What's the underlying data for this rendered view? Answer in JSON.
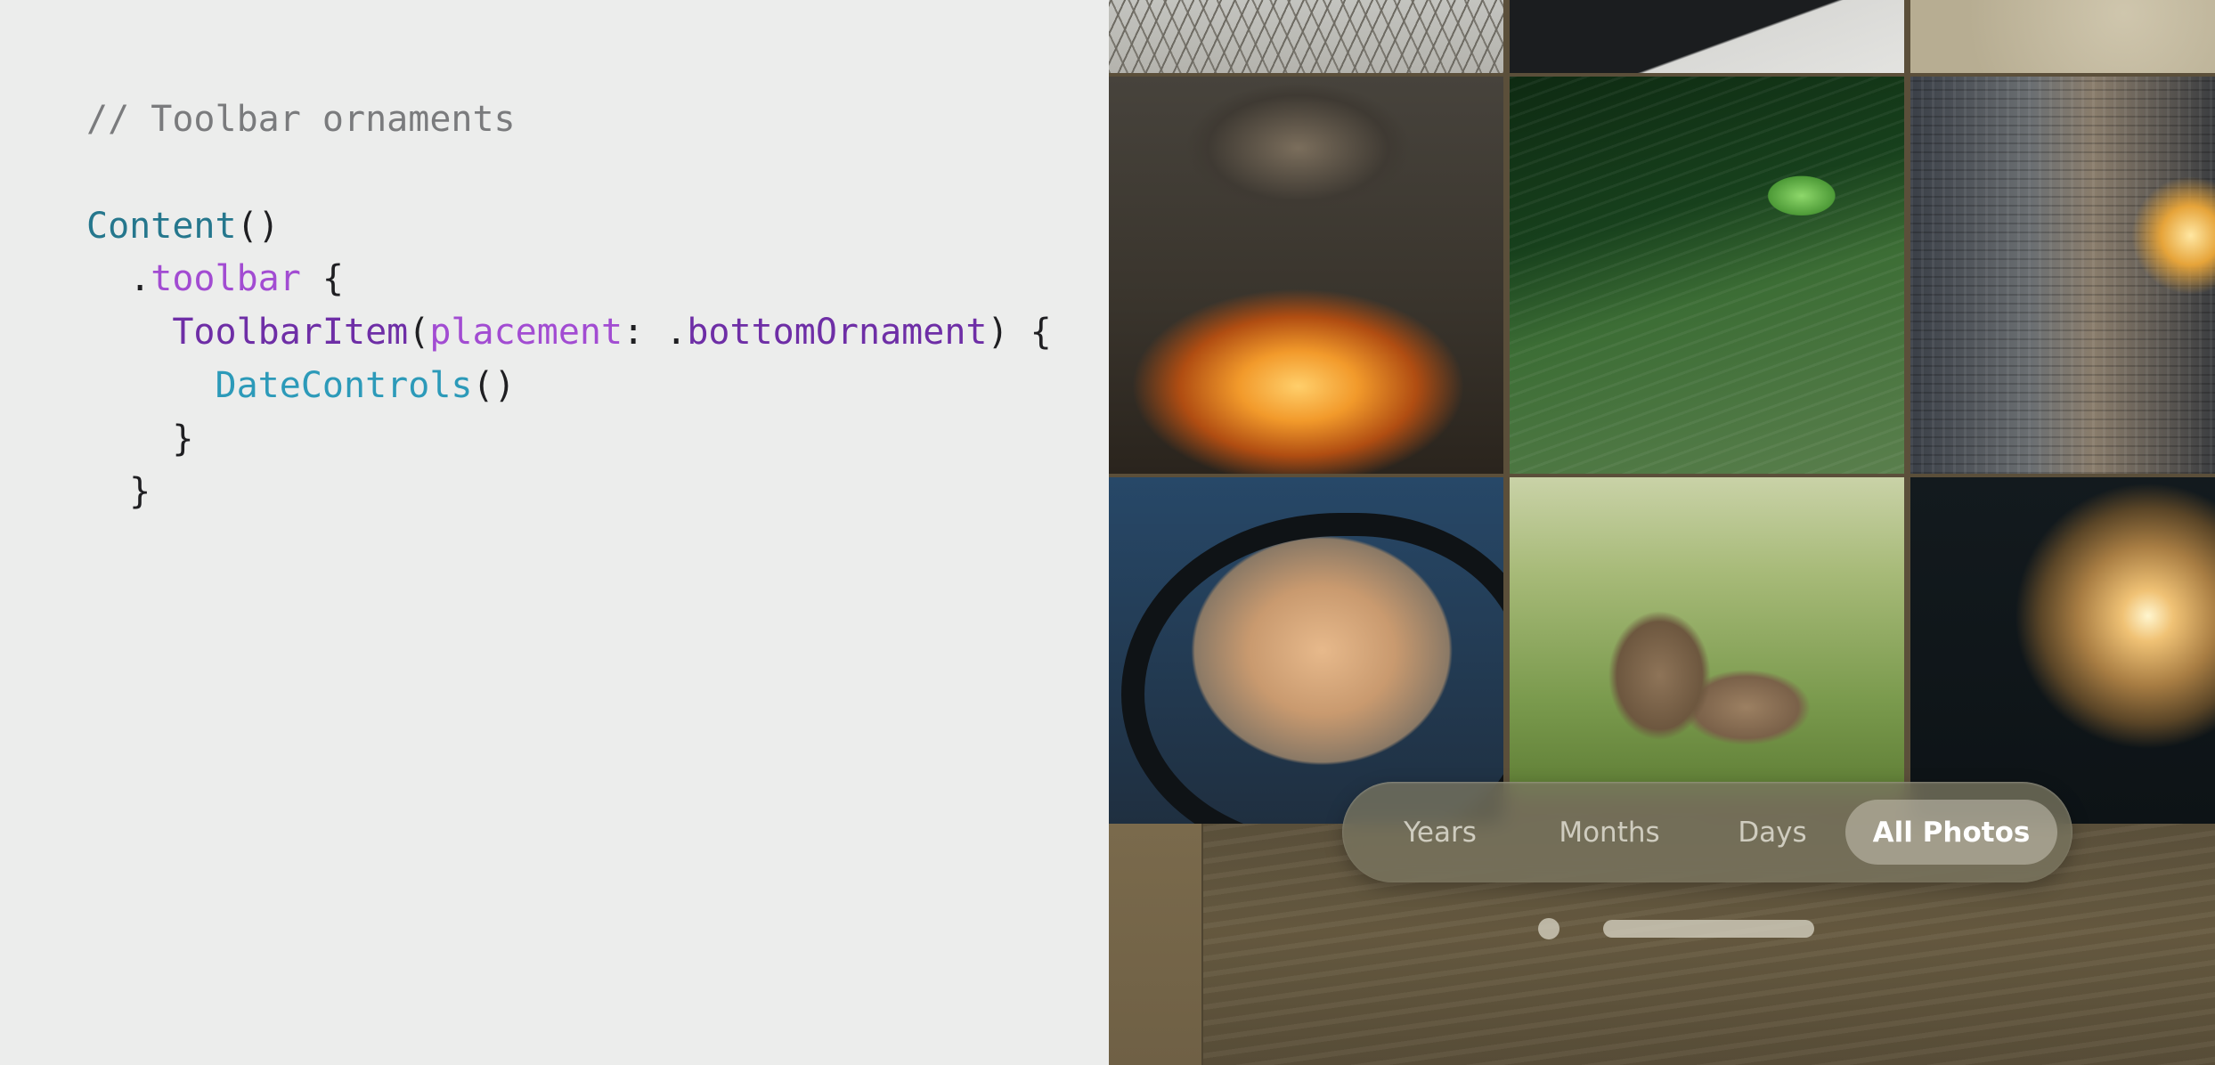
{
  "code": {
    "lines": [
      [
        {
          "t": "// Toolbar ornaments",
          "c": "comment"
        }
      ],
      [
        {
          "t": "Content",
          "c": "type"
        },
        {
          "t": "()",
          "c": "plain"
        }
      ],
      [
        {
          "t": "  .",
          "c": "plain"
        },
        {
          "t": "toolbar",
          "c": "method"
        },
        {
          "t": " {",
          "c": "plain"
        }
      ],
      [
        {
          "t": "    ",
          "c": "plain"
        },
        {
          "t": "ToolbarItem",
          "c": "decl"
        },
        {
          "t": "(",
          "c": "plain"
        },
        {
          "t": "placement",
          "c": "param"
        },
        {
          "t": ": .",
          "c": "plain"
        },
        {
          "t": "bottomOrnament",
          "c": "member"
        },
        {
          "t": ") {",
          "c": "plain"
        }
      ],
      [
        {
          "t": "      ",
          "c": "plain"
        },
        {
          "t": "DateControls",
          "c": "call"
        },
        {
          "t": "()",
          "c": "plain"
        }
      ],
      [
        {
          "t": "    }",
          "c": "plain"
        }
      ],
      [
        {
          "t": "  }",
          "c": "plain"
        }
      ]
    ]
  },
  "photos": [
    {
      "name": "branches-photo"
    },
    {
      "name": "dark-photo"
    },
    {
      "name": "sand-photo"
    },
    {
      "name": "campfire-pot-photo"
    },
    {
      "name": "frog-leaf-photo"
    },
    {
      "name": "street-lamp-photo"
    },
    {
      "name": "car-mirror-photo"
    },
    {
      "name": "deer-photo"
    },
    {
      "name": "light-bulb-photo"
    }
  ],
  "toolbar": {
    "segments": [
      {
        "label": "Years",
        "selected": false
      },
      {
        "label": "Months",
        "selected": false
      },
      {
        "label": "Days",
        "selected": false
      },
      {
        "label": "All Photos",
        "selected": true
      }
    ]
  },
  "colors": {
    "background": "#ecedec",
    "comment": "#7a7b7d",
    "type": "#25778d",
    "method": "#a24cd2",
    "declaration": "#6e2ea6",
    "call": "#2c9ab9"
  }
}
